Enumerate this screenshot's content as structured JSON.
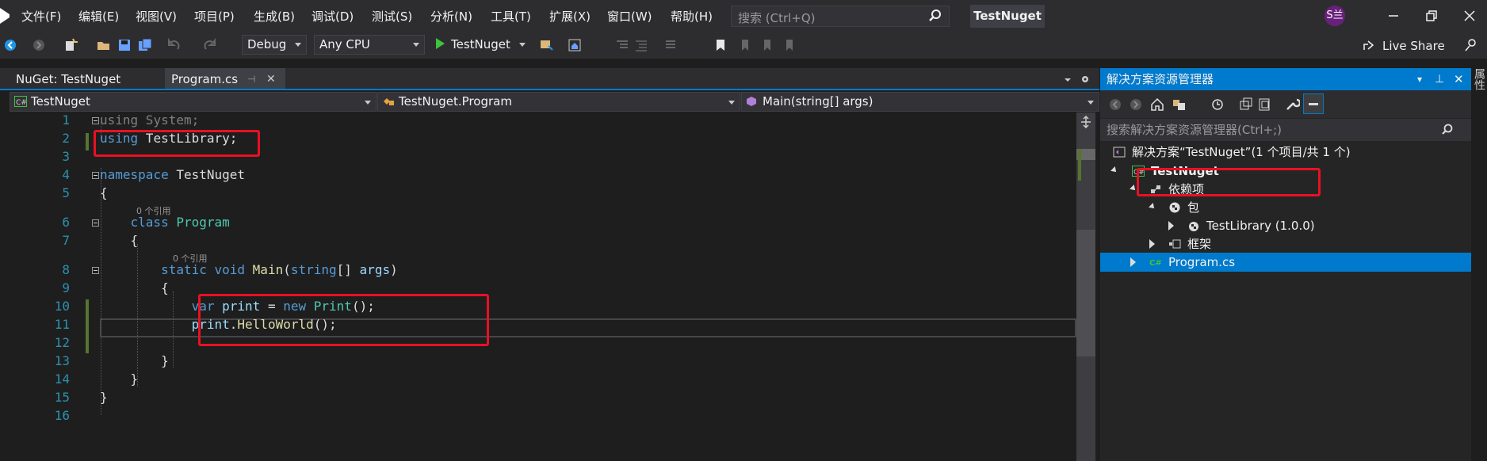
{
  "menu": [
    "文件(F)",
    "编辑(E)",
    "视图(V)",
    "项目(P)",
    "生成(B)",
    "调试(D)",
    "测试(S)",
    "分析(N)",
    "工具(T)",
    "扩展(X)",
    "窗口(W)",
    "帮助(H)"
  ],
  "search": {
    "placeholder": "搜索 (Ctrl+Q)"
  },
  "window_title": "TestNuget",
  "avatar_initials": "S兰",
  "toolbar": {
    "config": "Debug",
    "platform": "Any CPU",
    "run_label": "TestNuget",
    "live_share": "Live Share"
  },
  "tabs": [
    {
      "label": "NuGet: TestNuget"
    },
    {
      "label": "Program.cs"
    }
  ],
  "navbar": {
    "project": "TestNuget",
    "type": "TestNuget.Program",
    "member": "Main(string[] args)"
  },
  "editor": {
    "ref_hint": "0 个引用",
    "lines": [
      "1",
      "2",
      "3",
      "4",
      "5",
      "6",
      "7",
      "8",
      "9",
      "10",
      "11",
      "12",
      "13",
      "14",
      "15",
      "16"
    ]
  },
  "solution_explorer": {
    "title": "解决方案资源管理器",
    "search_placeholder": "搜索解决方案资源管理器(Ctrl+;)",
    "solution": "解决方案“TestNuget”(1 个项目/共 1 个)",
    "project": "TestNuget",
    "dependencies": "依赖项",
    "packages": "包",
    "package_item": "TestLibrary (1.0.0)",
    "frameworks": "框架",
    "file": "Program.cs"
  },
  "properties_tab": "属性",
  "colors": {
    "accent": "#007acc",
    "highlight_box": "#e81123",
    "keyword": "#569cd6",
    "type": "#4ec9b0"
  }
}
